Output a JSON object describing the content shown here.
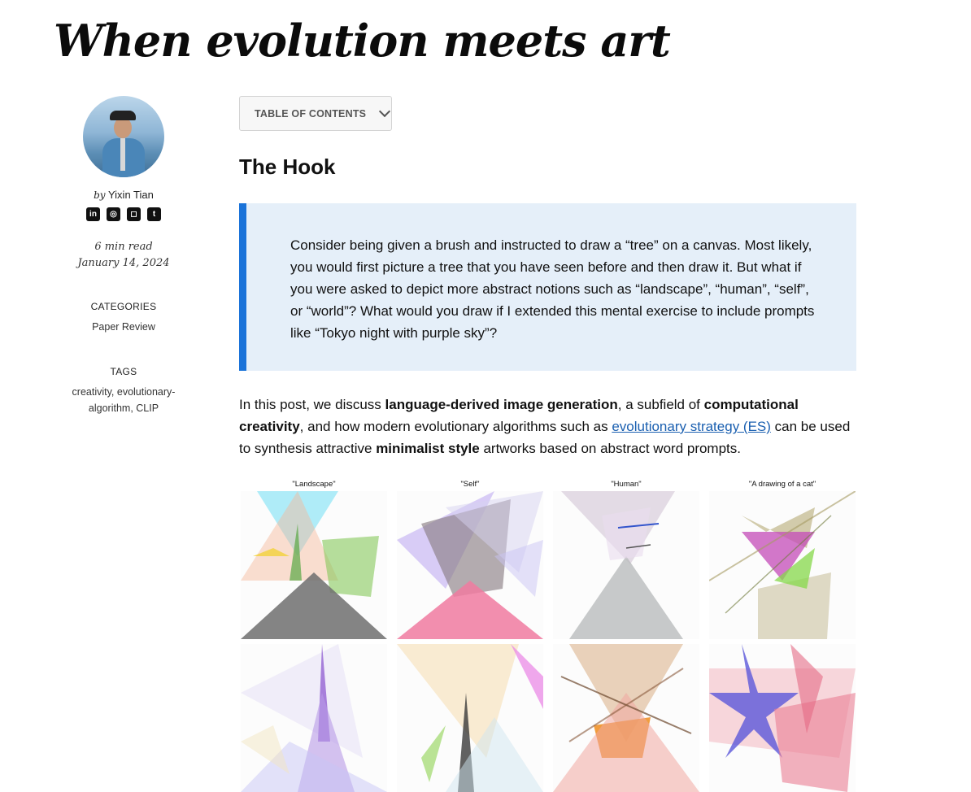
{
  "page": {
    "title": "When evolution meets art"
  },
  "author": {
    "by": "by",
    "name": "Yixin Tian"
  },
  "social": [
    "linkedin-icon",
    "github-icon",
    "instagram-icon",
    "twitter-icon"
  ],
  "meta": {
    "read_time": "6 min read",
    "date": "January 14, 2024"
  },
  "categories": {
    "heading": "CATEGORIES",
    "value": "Paper Review"
  },
  "tags": {
    "heading": "TAGS",
    "line1": "creativity, evolutionary-",
    "line2": "algorithm, CLIP"
  },
  "toc": {
    "label": "TABLE OF CONTENTS"
  },
  "section": {
    "heading": "The Hook"
  },
  "callout": {
    "text": "Consider being given a brush and instructed to draw a “tree” on a canvas. Most likely, you would first picture a tree that you have seen before and then draw it. But what if you were asked to depict more abstract notions such as “landscape”, “human”, “self”, or “world”? What would you draw if I extended this mental exercise to include prompts like “Tokyo night with purple sky”?"
  },
  "intro": {
    "t1": "In this post, we discuss ",
    "b1": "language-derived image generation",
    "t2": ", a subfield of ",
    "b2": "computational creativity",
    "t3": ", and how modern evolutionary algorithms such as ",
    "link": "evolutionary strategy (ES)",
    "t4": " can be used to synthesis attractive ",
    "b3": "minimalist style",
    "t5": " artworks based on abstract word prompts."
  },
  "artworks": {
    "captions": [
      "\"Landscape\"",
      "\"Self\"",
      "\"Human\"",
      "\"A drawing of a cat\""
    ]
  },
  "colors": {
    "accent": "#1a73d9",
    "callout_bg": "#e5eff9",
    "link": "#1a5fb0"
  }
}
